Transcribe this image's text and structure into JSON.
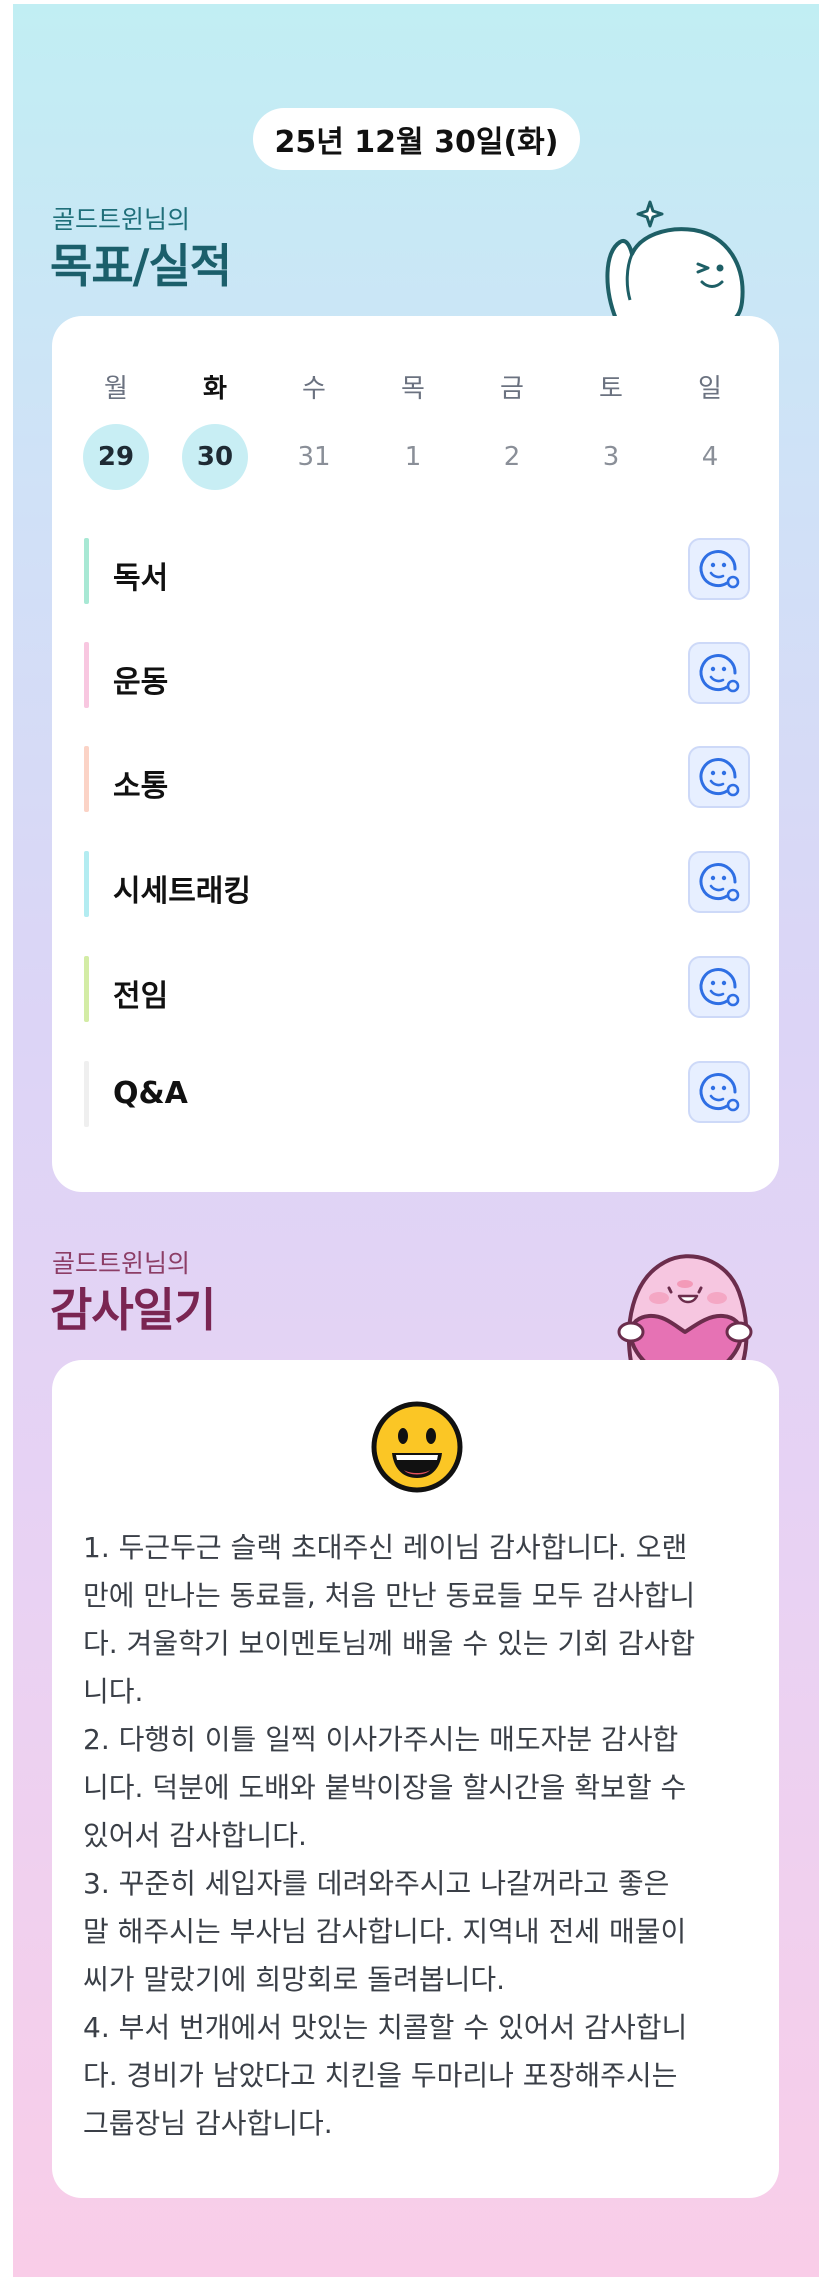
{
  "date": "25년 12월 30일(화)",
  "goals_section": {
    "subtitle": "골드트윈님의",
    "title": "목표/실적"
  },
  "week": {
    "weekdays": [
      "월",
      "화",
      "수",
      "목",
      "금",
      "토",
      "일"
    ],
    "days": [
      "29",
      "30",
      "31",
      "1",
      "2",
      "3",
      "4"
    ],
    "today_index": 1,
    "active_indexes": [
      0,
      1
    ]
  },
  "goals": [
    {
      "label": "독서",
      "color": "#a8e8d4",
      "icon": "smiley-add-icon"
    },
    {
      "label": "운동",
      "color": "#f8c7e0",
      "icon": "smiley-add-icon"
    },
    {
      "label": "소통",
      "color": "#fbd3c6",
      "icon": "smiley-add-icon"
    },
    {
      "label": "시세트래킹",
      "color": "#b3ecf1",
      "icon": "smiley-add-icon"
    },
    {
      "label": "전임",
      "color": "#d3eca5",
      "icon": "smiley-add-icon"
    },
    {
      "label": "Q&A",
      "color": "#efefef",
      "icon": "smiley-add-icon"
    }
  ],
  "diary_section": {
    "subtitle": "골드트윈님의",
    "title": "감사일기",
    "emoji": "grinning-face-icon",
    "text": "1. 두근두근 슬랙 초대주신 레이님 감사합니다. 오랜\n만에 만나는 동료들, 처음 만난 동료들 모두 감사합니\n다. 겨울학기 보이멘토님께 배울 수 있는 기회 감사합\n니다.\n2. 다행히 이틀 일찍 이사가주시는 매도자분 감사합\n니다. 덕분에 도배와 붙박이장을 할시간을 확보할 수\n있어서 감사합니다.\n3. 꾸준히 세입자를 데려와주시고 나갈꺼라고 좋은\n말 해주시는 부사님 감사합니다. 지역내 전세 매물이\n씨가 말랐기에 희망회로 돌려봅니다.\n4. 부서 번개에서 맛있는 치콜할 수 있어서 감사합니\n다. 경비가 남았다고 치킨을 두마리나 포장해주시는\n그룹장님 감사합니다."
  },
  "colors": {
    "accent_blue": "#2f6fe4",
    "teal_title": "#1b5f6b",
    "pink_title": "#7a2552"
  }
}
